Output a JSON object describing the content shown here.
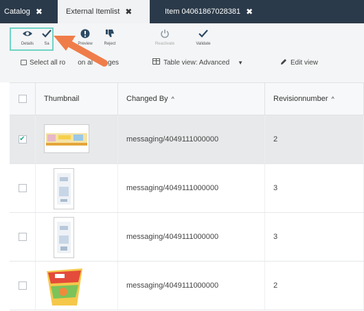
{
  "tabs": [
    {
      "label": "Catalog",
      "active": false
    },
    {
      "label": "External Itemlist",
      "active": true
    },
    {
      "label": "Item 04061867028381",
      "active": false
    }
  ],
  "toolbar": {
    "details_label": "Details",
    "second_label": "Sa",
    "preview_label": "Preview",
    "reject_label": "Reject",
    "reactivate_label": "Reactivate",
    "validate_label": "Validate",
    "select_all_label": "Select all ro",
    "select_all_suffix": "ges",
    "select_all_mid": "on al",
    "table_view_label": "Table view: Advanced",
    "edit_view_label": "Edit view"
  },
  "table": {
    "headers": {
      "thumbnail": "Thumbnail",
      "changed_by": "Changed By",
      "revision": "Revisionnumber"
    },
    "rows": [
      {
        "changed_by": "messaging/4049111000000",
        "revision": "2",
        "selected": true
      },
      {
        "changed_by": "messaging/4049111000000",
        "revision": "3",
        "selected": false
      },
      {
        "changed_by": "messaging/4049111000000",
        "revision": "3",
        "selected": false
      },
      {
        "changed_by": "messaging/4049111000000",
        "revision": "2",
        "selected": false
      }
    ]
  },
  "colors": {
    "tabbar": "#2b3a4a",
    "highlight": "#6fd3c6",
    "arrow": "#ef7d4a",
    "icon": "#2d4a63"
  }
}
